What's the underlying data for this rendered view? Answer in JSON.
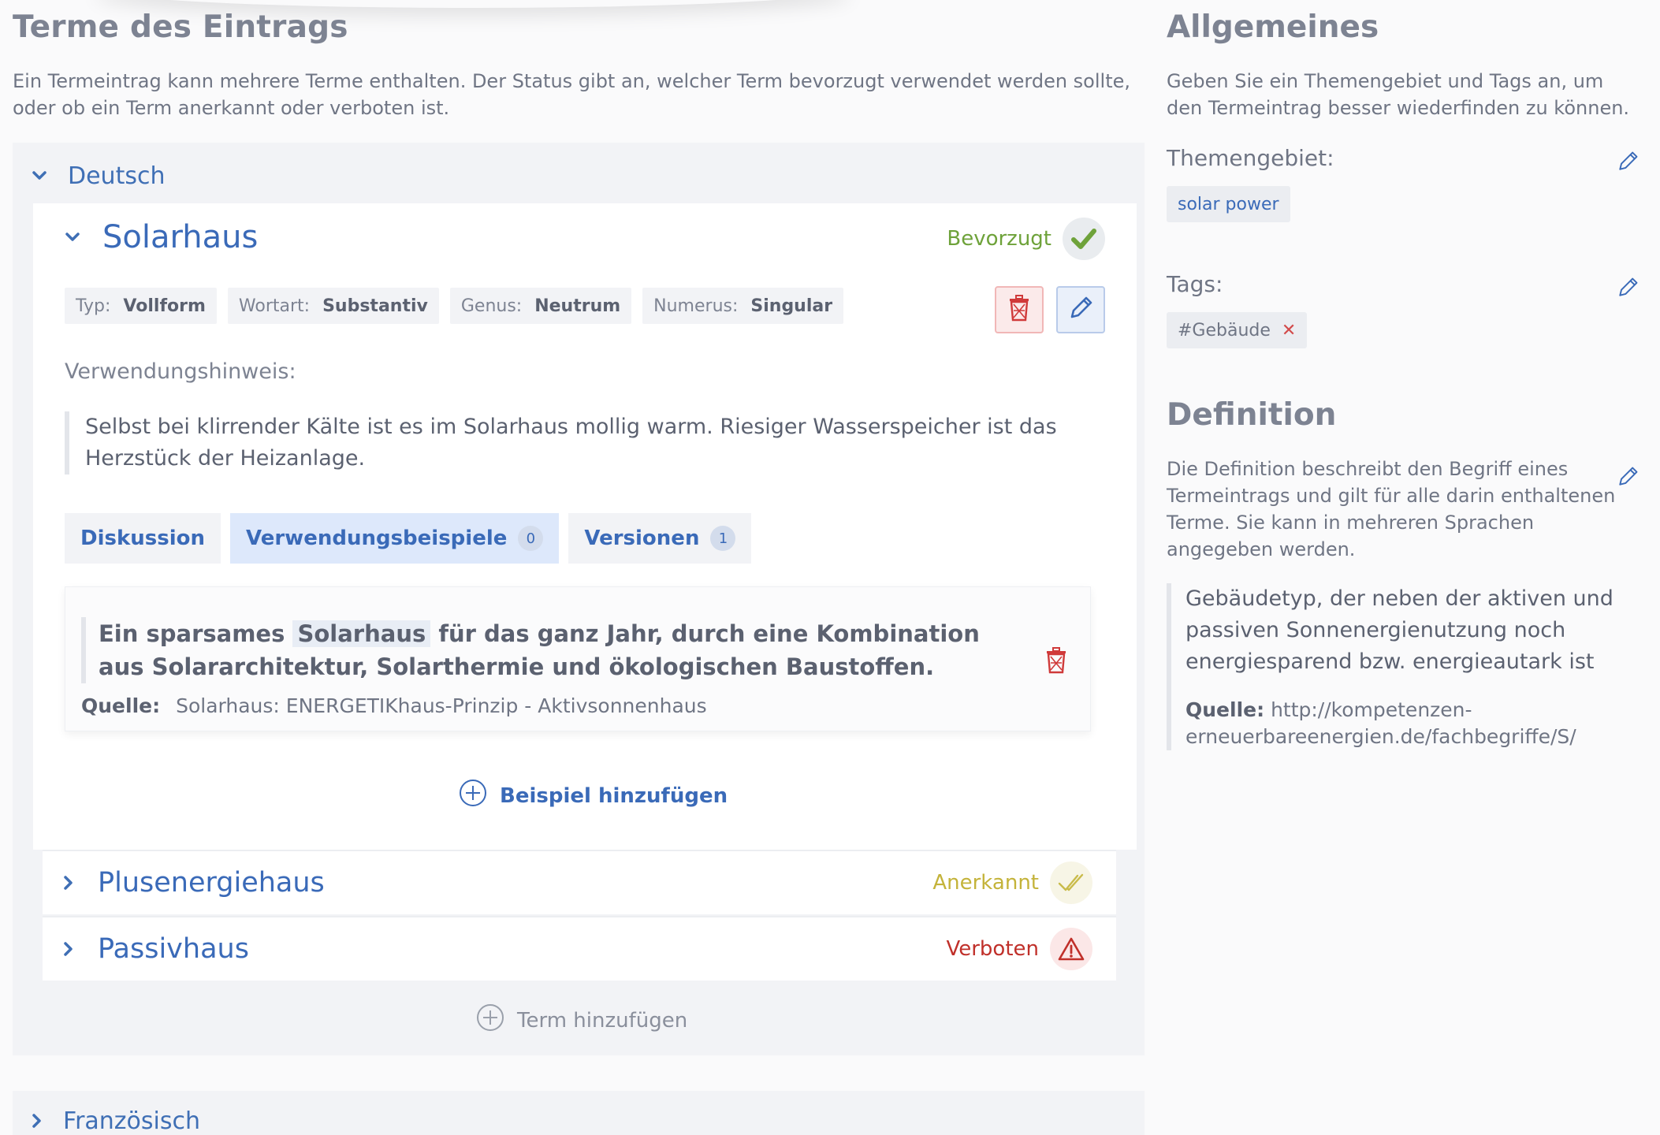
{
  "terms_section": {
    "title": "Terme des Eintrags",
    "description": "Ein Termeintrag kann mehrere Terme enthalten. Der Status gibt an, welcher Term bevorzugt verwendet werden sollte, oder ob ein Term anerkannt oder verboten ist."
  },
  "languages": [
    {
      "label": "Deutsch",
      "expanded": true,
      "terms": [
        {
          "title": "Solarhaus",
          "status": "Bevorzugt",
          "status_color": "#6ea23a",
          "props": [
            {
              "key": "Typ:",
              "value": "Vollform"
            },
            {
              "key": "Wortart:",
              "value": "Substantiv"
            },
            {
              "key": "Genus:",
              "value": "Neutrum"
            },
            {
              "key": "Numerus:",
              "value": "Singular"
            }
          ],
          "usage_hint_label": "Verwendungshinweis:",
          "usage_hint": "Selbst bei klirrender Kälte ist es im Solarhaus mollig warm. Riesiger Wasserspeicher ist das Herzstück der Heizanlage.",
          "tabs": [
            {
              "label": "Diskussion",
              "count": null
            },
            {
              "label": "Verwendungsbeispiele",
              "count": "0"
            },
            {
              "label": "Versionen",
              "count": "1"
            }
          ],
          "example": {
            "before": "Ein sparsames",
            "highlight": "Solarhaus",
            "after": "für das ganz Jahr, durch eine Kombination aus Solararchitektur, Solarthermie und ökologischen Baustoffen.",
            "source_label": "Quelle:",
            "source": "Solarhaus: ENERGETIKhaus-Prinzip - Aktivsonnenhaus"
          },
          "add_example_label": "Beispiel hinzufügen"
        },
        {
          "title": "Plusenergiehaus",
          "status": "Anerkannt",
          "status_color": "#c4b33a"
        },
        {
          "title": "Passivhaus",
          "status": "Verboten",
          "status_color": "#c0302a"
        }
      ],
      "add_term_label": "Term hinzufügen"
    },
    {
      "label": "Französisch",
      "expanded": false
    }
  ],
  "general": {
    "title": "Allgemeines",
    "description": "Geben Sie ein Themengebiet und Tags an, um den Termeintrag besser wiederfinden zu können.",
    "subject_label": "Themengebiet:",
    "subject_value": "solar power",
    "tags_label": "Tags:",
    "tags": [
      "#Gebäude"
    ]
  },
  "definition": {
    "title": "Definition",
    "description": "Die Definition beschreibt den Begriff eines Termeintrags und gilt für alle darin enthaltenen Terme. Sie kann in mehreren Sprachen angegeben werden.",
    "text": "Gebäudetyp, der neben der aktiven und passiven Sonnenergienutzung noch energiesparend bzw. energieautark ist",
    "source_label": "Quelle:",
    "source": "http://kompetenzen-erneuerbareenergien.de/fachbegriffe/S/"
  },
  "colors": {
    "accent": "#3a6ab8",
    "preferred": "#6ea23a",
    "accepted": "#c4b33a",
    "forbidden": "#c0302a"
  }
}
